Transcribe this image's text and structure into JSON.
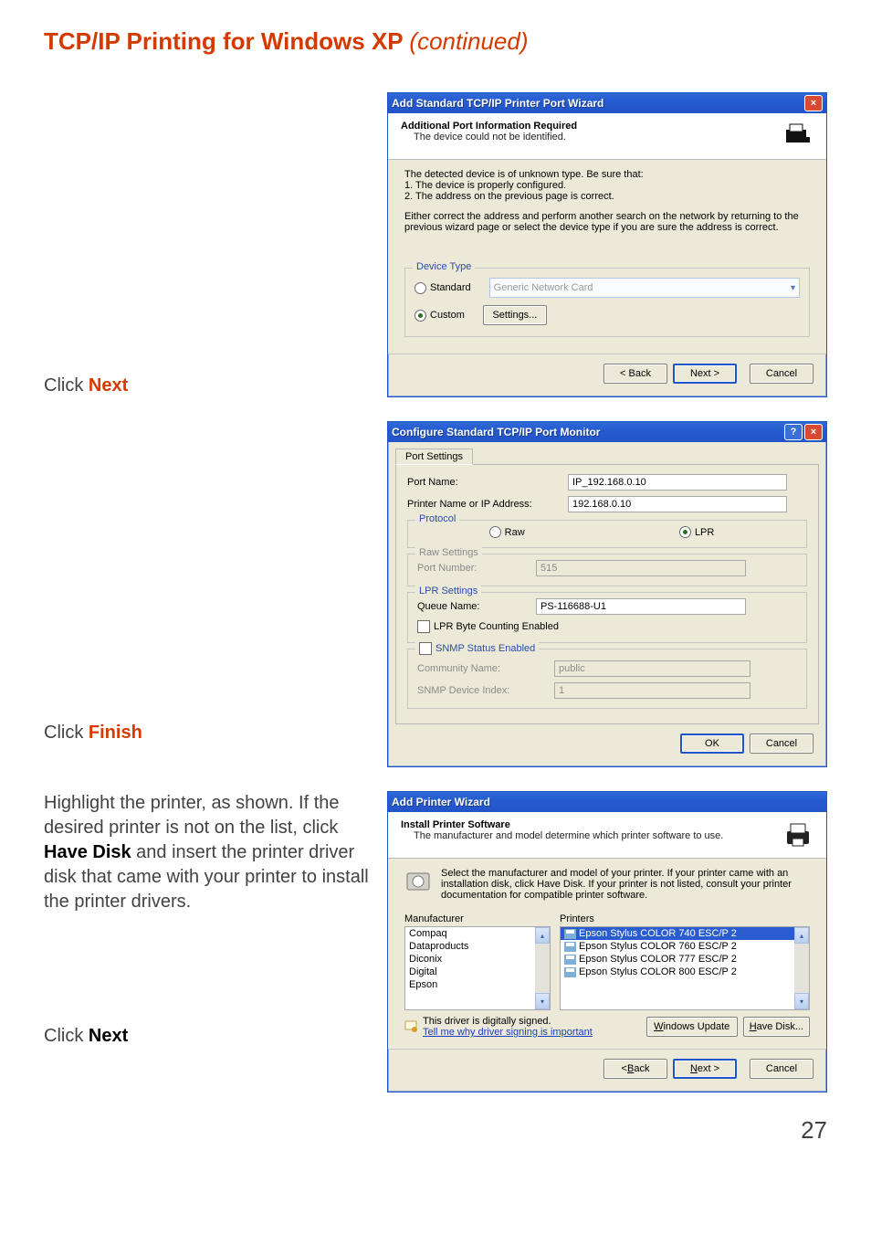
{
  "heading": {
    "main": "TCP/IP Printing for Windows XP",
    "cont": "(continued)"
  },
  "row1": {
    "label": "Click",
    "action": "Next"
  },
  "win1": {
    "title": "Add Standard TCP/IP Printer Port Wizard",
    "banner_h": "Additional Port Information Required",
    "banner_s": "The device could not be identified.",
    "para1": "The detected device is of unknown type.  Be sure that:",
    "para1_1": "1.  The device is properly configured.",
    "para1_2": "2.  The address on the previous page is correct.",
    "para2": "Either correct the address and perform another search on the network by returning to the previous wizard page or select the device type if you are sure the address is correct.",
    "device_type": "Device Type",
    "standard": "Standard",
    "std_val": "Generic Network Card",
    "custom": "Custom",
    "settings": "Settings...",
    "back": "< Back",
    "next": "Next >",
    "cancel": "Cancel"
  },
  "row2": {
    "label": "Click",
    "action": "Finish"
  },
  "win2": {
    "title": "Configure Standard TCP/IP Port Monitor",
    "tab": "Port Settings",
    "port_name_l": "Port Name:",
    "port_name_v": "IP_192.168.0.10",
    "addr_l": "Printer Name or IP Address:",
    "addr_v": "192.168.0.10",
    "protocol": "Protocol",
    "raw": "Raw",
    "lpr": "LPR",
    "raw_set": "Raw Settings",
    "portnum_l": "Port Number:",
    "portnum_v": "515",
    "lpr_set": "LPR Settings",
    "queue_l": "Queue Name:",
    "queue_v": "PS-116688-U1",
    "lprcnt": "LPR Byte Counting Enabled",
    "snmp": "SNMP Status Enabled",
    "comm_l": "Community Name:",
    "comm_v": "public",
    "idx_l": "SNMP Device Index:",
    "idx_v": "1",
    "ok": "OK",
    "cancel": "Cancel"
  },
  "row3": {
    "t1": "Highlight the printer, as shown. If the desired printer is not on the list, click ",
    "bold": "Have Disk",
    "t2": " and insert the printer driver disk that came with your printer to install the printer drivers."
  },
  "win3": {
    "title": "Add Printer Wizard",
    "banner_h": "Install Printer Software",
    "banner_s": "The manufacturer and model determine which printer software to use.",
    "hint": "Select the manufacturer and model of your printer. If your printer came with an installation disk, click Have Disk. If your printer is not listed, consult your printer documentation for compatible printer software.",
    "manu_h": "Manufacturer",
    "prn_h": "Printers",
    "manu": [
      "Compaq",
      "Dataproducts",
      "Diconix",
      "Digital",
      "Epson"
    ],
    "prn": [
      "Epson Stylus COLOR 740 ESC/P 2",
      "Epson Stylus COLOR 760 ESC/P 2",
      "Epson Stylus COLOR 777 ESC/P 2",
      "Epson Stylus COLOR 800 ESC/P 2"
    ],
    "signed": "This driver is digitally signed.",
    "tell": "Tell me why driver signing is important",
    "wu_pre": "W",
    "wu_post": "indows Update",
    "hd_pre": "H",
    "hd_post": "ave Disk...",
    "back_pre": "< ",
    "back_u": "B",
    "back_post": "ack",
    "next_u": "N",
    "next_post": "ext >",
    "cancel": "Cancel"
  },
  "row4": {
    "label": "Click",
    "action": "Next"
  },
  "page_num": "27"
}
